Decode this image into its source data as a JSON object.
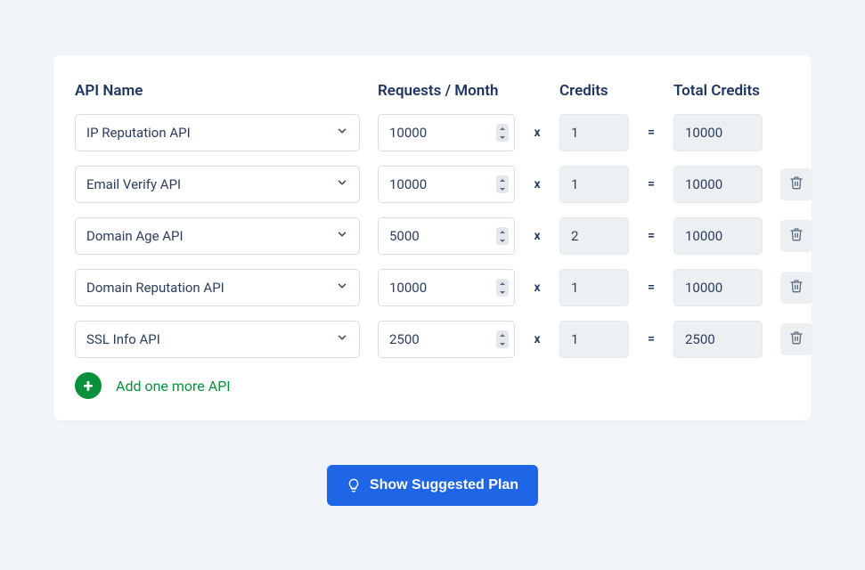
{
  "headers": {
    "name": "API Name",
    "requests": "Requests / Month",
    "credits": "Credits",
    "total": "Total Credits"
  },
  "rows": [
    {
      "name": "IP Reputation API",
      "requests": "10000",
      "credits": "1",
      "total": "10000",
      "trash": false
    },
    {
      "name": "Email Verify API",
      "requests": "10000",
      "credits": "1",
      "total": "10000",
      "trash": true
    },
    {
      "name": "Domain Age API",
      "requests": "5000",
      "credits": "2",
      "total": "10000",
      "trash": true
    },
    {
      "name": "Domain Reputation API",
      "requests": "10000",
      "credits": "1",
      "total": "10000",
      "trash": true
    },
    {
      "name": "SSL Info API",
      "requests": "2500",
      "credits": "1",
      "total": "2500",
      "trash": true
    }
  ],
  "symbols": {
    "times": "x",
    "equals": "="
  },
  "add_label": "Add one more API",
  "cta_label": "Show Suggested Plan"
}
